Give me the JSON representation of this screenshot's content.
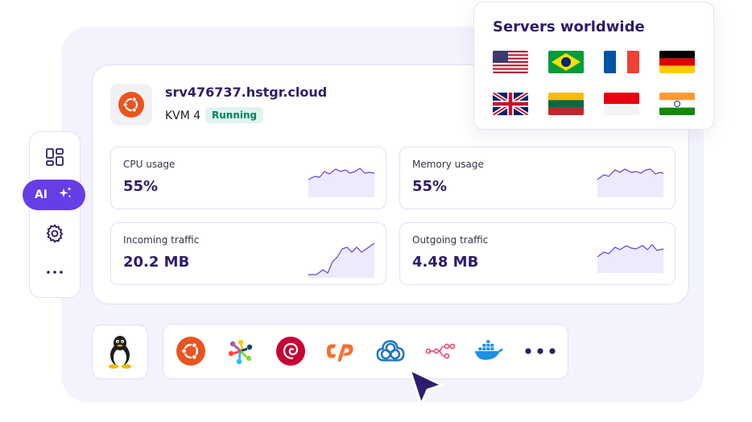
{
  "server": {
    "hostname": "srv476737.hstgr.cloud",
    "plan": "KVM 4",
    "status": "Running",
    "os_icon": "ubuntu-icon"
  },
  "metrics": [
    {
      "label": "CPU usage",
      "value": "55%"
    },
    {
      "label": "Memory usage",
      "value": "55%"
    },
    {
      "label": "Incoming traffic",
      "value": "20.2 MB"
    },
    {
      "label": "Outgoing traffic",
      "value": "4.48 MB"
    }
  ],
  "toolbar": {
    "items": [
      "dashboard-icon",
      "ai-assistant",
      "settings-icon",
      "more-icon"
    ],
    "ai_label": "AI"
  },
  "servers": {
    "title": "Servers worldwide",
    "flags": [
      "us-flag",
      "brazil-flag",
      "france-flag",
      "germany-flag",
      "uk-flag",
      "lithuania-flag",
      "indonesia-flag",
      "india-flag"
    ]
  },
  "apps": [
    "linux-icon",
    "ubuntu-icon",
    "almalinux-icon",
    "debian-icon",
    "cpanel-icon",
    "cloudpanel-icon",
    "n8n-icon",
    "docker-icon",
    "more-icon"
  ],
  "colors": {
    "accent": "#673de6",
    "brand_text": "#2f1c6a",
    "status_bg": "#def4f0",
    "status_text": "#008361",
    "panel_bg": "#f3f3fd"
  }
}
